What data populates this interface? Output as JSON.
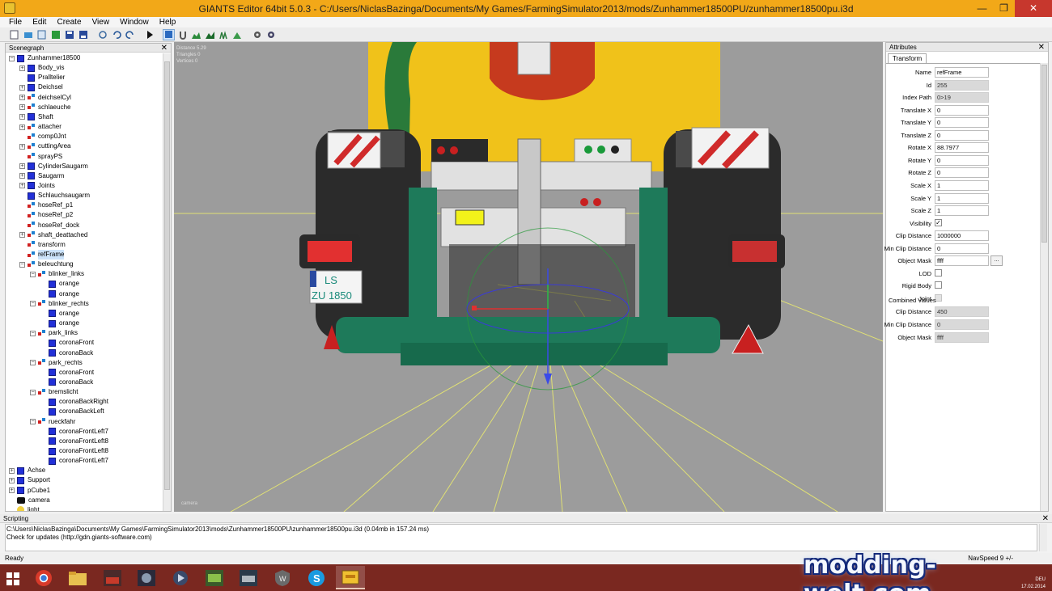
{
  "window": {
    "title": "GIANTS Editor 64bit 5.0.3 - C:/Users/NiclasBazinga/Documents/My Games/FarmingSimulator2013/mods/Zunhammer18500PU/zunhammer18500pu.i3d"
  },
  "menu": [
    "File",
    "Edit",
    "Create",
    "View",
    "Window",
    "Help"
  ],
  "scenegraph": {
    "title": "Scenegraph",
    "nodes": [
      {
        "label": "Zunhammer18500",
        "icon": "cube",
        "exp": "-",
        "depth": 0
      },
      {
        "label": "Body_vis",
        "icon": "cube",
        "exp": "+",
        "depth": 1
      },
      {
        "label": "Pralltelier",
        "icon": "cube",
        "exp": "",
        "depth": 1
      },
      {
        "label": "Deichsel",
        "icon": "cube",
        "exp": "+",
        "depth": 1
      },
      {
        "label": "deichselCyl",
        "icon": "group",
        "exp": "+",
        "depth": 1
      },
      {
        "label": "schlaeuche",
        "icon": "group",
        "exp": "+",
        "depth": 1
      },
      {
        "label": "Shaft",
        "icon": "cube",
        "exp": "+",
        "depth": 1
      },
      {
        "label": "attacher",
        "icon": "group",
        "exp": "+",
        "depth": 1
      },
      {
        "label": "comp0Jnt",
        "icon": "group",
        "exp": "",
        "depth": 1
      },
      {
        "label": "cuttingArea",
        "icon": "group",
        "exp": "+",
        "depth": 1
      },
      {
        "label": "sprayPS",
        "icon": "group",
        "exp": "",
        "depth": 1
      },
      {
        "label": "CylinderSaugarm",
        "icon": "cube",
        "exp": "+",
        "depth": 1
      },
      {
        "label": "Saugarm",
        "icon": "cube",
        "exp": "+",
        "depth": 1
      },
      {
        "label": "Joints",
        "icon": "cube",
        "exp": "+",
        "depth": 1
      },
      {
        "label": "Schlauchsaugarm",
        "icon": "cube",
        "exp": "",
        "depth": 1
      },
      {
        "label": "hoseRef_p1",
        "icon": "group",
        "exp": "",
        "depth": 1
      },
      {
        "label": "hoseRef_p2",
        "icon": "group",
        "exp": "",
        "depth": 1
      },
      {
        "label": "hoseRef_dock",
        "icon": "group",
        "exp": "",
        "depth": 1
      },
      {
        "label": "shaft_deattached",
        "icon": "group",
        "exp": "+",
        "depth": 1
      },
      {
        "label": "transform",
        "icon": "group",
        "exp": "",
        "depth": 1
      },
      {
        "label": "refFrame",
        "icon": "group",
        "exp": "",
        "depth": 1,
        "selected": true
      },
      {
        "label": "beleuchtung",
        "icon": "group",
        "exp": "-",
        "depth": 1
      },
      {
        "label": "blinker_links",
        "icon": "group",
        "exp": "-",
        "depth": 2
      },
      {
        "label": "orange",
        "icon": "cube",
        "exp": "",
        "depth": 3
      },
      {
        "label": "orange",
        "icon": "cube",
        "exp": "",
        "depth": 3
      },
      {
        "label": "blinker_rechts",
        "icon": "group",
        "exp": "-",
        "depth": 2
      },
      {
        "label": "orange",
        "icon": "cube",
        "exp": "",
        "depth": 3
      },
      {
        "label": "orange",
        "icon": "cube",
        "exp": "",
        "depth": 3
      },
      {
        "label": "park_links",
        "icon": "group",
        "exp": "-",
        "depth": 2
      },
      {
        "label": "coronaFront",
        "icon": "cube",
        "exp": "",
        "depth": 3
      },
      {
        "label": "coronaBack",
        "icon": "cube",
        "exp": "",
        "depth": 3
      },
      {
        "label": "park_rechts",
        "icon": "group",
        "exp": "-",
        "depth": 2
      },
      {
        "label": "coronaFront",
        "icon": "cube",
        "exp": "",
        "depth": 3
      },
      {
        "label": "coronaBack",
        "icon": "cube",
        "exp": "",
        "depth": 3
      },
      {
        "label": "bremslicht",
        "icon": "group",
        "exp": "-",
        "depth": 2
      },
      {
        "label": "coronaBackRight",
        "icon": "cube",
        "exp": "",
        "depth": 3
      },
      {
        "label": "coronaBackLeft",
        "icon": "cube",
        "exp": "",
        "depth": 3
      },
      {
        "label": "rueckfahr",
        "icon": "group",
        "exp": "-",
        "depth": 2
      },
      {
        "label": "coronaFrontLeft7",
        "icon": "cube",
        "exp": "",
        "depth": 3
      },
      {
        "label": "coronaFrontLeft8",
        "icon": "cube",
        "exp": "",
        "depth": 3
      },
      {
        "label": "coronaFrontLeft8",
        "icon": "cube",
        "exp": "",
        "depth": 3
      },
      {
        "label": "coronaFrontLeft7",
        "icon": "cube",
        "exp": "",
        "depth": 3
      },
      {
        "label": "Achse",
        "icon": "cube",
        "exp": "+",
        "depth": 0
      },
      {
        "label": "Support",
        "icon": "cube",
        "exp": "+",
        "depth": 0
      },
      {
        "label": "pCube1",
        "icon": "cube",
        "exp": "+",
        "depth": 0
      },
      {
        "label": "camera",
        "icon": "camera",
        "exp": "",
        "depth": 0
      },
      {
        "label": "light",
        "icon": "light",
        "exp": "",
        "depth": 0
      }
    ]
  },
  "viewport": {
    "stats": [
      "Distance 5.29",
      "Triangles 0",
      "Vertices 0"
    ],
    "camera_label": "camera",
    "plate_top": "LS",
    "plate_bottom": "ZU 1850",
    "colors": {
      "bg": "#9c9c9c",
      "tank": "#f0c21a",
      "frame": "#1e7a5a"
    }
  },
  "attributes": {
    "title": "Attributes",
    "tab": "Transform",
    "fields": [
      {
        "label": "Name",
        "value": "refFrame",
        "kind": "text"
      },
      {
        "label": "Id",
        "value": "255",
        "kind": "readonly"
      },
      {
        "label": "Index Path",
        "value": "0>19",
        "kind": "readonly"
      },
      {
        "label": "Translate X",
        "value": "0",
        "kind": "text"
      },
      {
        "label": "Translate Y",
        "value": "0",
        "kind": "text"
      },
      {
        "label": "Translate Z",
        "value": "0",
        "kind": "text"
      },
      {
        "label": "Rotate X",
        "value": "88.7977",
        "kind": "text"
      },
      {
        "label": "Rotate Y",
        "value": "0",
        "kind": "text"
      },
      {
        "label": "Rotate Z",
        "value": "0",
        "kind": "text"
      },
      {
        "label": "Scale X",
        "value": "1",
        "kind": "text"
      },
      {
        "label": "Scale Y",
        "value": "1",
        "kind": "text"
      },
      {
        "label": "Scale Z",
        "value": "1",
        "kind": "text"
      },
      {
        "label": "Visibility",
        "value": "checked",
        "kind": "check"
      },
      {
        "label": "Clip Distance",
        "value": "1000000",
        "kind": "text"
      },
      {
        "label": "Min Clip Distance",
        "value": "0",
        "kind": "text"
      },
      {
        "label": "Object Mask",
        "value": "ffff",
        "kind": "textmore"
      },
      {
        "label": "LOD",
        "value": "",
        "kind": "check"
      },
      {
        "label": "Rigid Body",
        "value": "",
        "kind": "check"
      },
      {
        "label": "Joint",
        "value": "",
        "kind": "checkdisabled"
      }
    ],
    "combined_title": "Combined Values",
    "combined": [
      {
        "label": "Clip Distance",
        "value": "450"
      },
      {
        "label": "Min Clip Distance",
        "value": "0"
      },
      {
        "label": "Object Mask",
        "value": "ffff"
      }
    ],
    "more_label": "..."
  },
  "scripting": {
    "title": "Scripting",
    "lines": [
      "C:\\Users\\NiclasBazinga\\Documents\\My Games\\FarmingSimulator2013\\mods\\Zunhammer18500PU\\zunhammer18500pu.i3d (0.04mb in 157.24 ms)",
      "Check for updates (http://gdn.giants-software.com)"
    ]
  },
  "status": {
    "text": "Ready",
    "speed": "NavSpeed 9 +/-"
  },
  "tray": {
    "lang": "DEU",
    "date": "17.02.2014"
  },
  "watermark": "modding-welt.com"
}
